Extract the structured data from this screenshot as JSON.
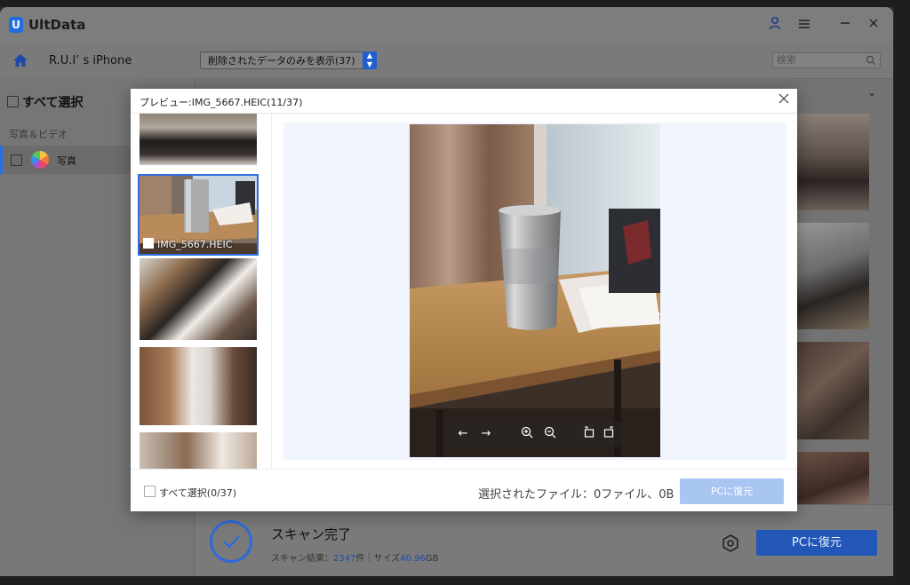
{
  "app": {
    "title": "UltData",
    "logo_letter": "U"
  },
  "device": {
    "name": "R.U.I’ s iPhone"
  },
  "sidebar": {
    "select_all": "すべて選択",
    "category": "写真＆ビデオ",
    "items": [
      {
        "label": "写真",
        "icon": "photos-icon"
      }
    ]
  },
  "toolbar": {
    "filter": "削除されたデータのみを表示(37)",
    "search_placeholder": "検索"
  },
  "modal": {
    "title": "プレビュー:IMG_5667.HEIC(11/37)",
    "selected_thumb_label": "IMG_5667.HEIC",
    "select_all": "すべて選択(0/37)",
    "selected_files": "選択されたファイル：0ファイル、0B",
    "restore_button": "PCに復元",
    "controls": [
      "arrow-left-icon",
      "arrow-right-icon",
      "zoom-in-icon",
      "zoom-out-icon",
      "rotate-left-icon",
      "rotate-right-icon"
    ]
  },
  "scan": {
    "title": "スキャン完了",
    "result_prefix": "スキャン結果：",
    "result_count": "2347",
    "result_unit": "件",
    "size_prefix": "｜サイズ",
    "size_value": "40.96",
    "size_unit": "GB",
    "restore_button": "PCに復元"
  },
  "colors": {
    "accent": "#2f6ee0",
    "restore_disabled": "#a9c6f2",
    "preview_bg": "#f1f5fe"
  }
}
